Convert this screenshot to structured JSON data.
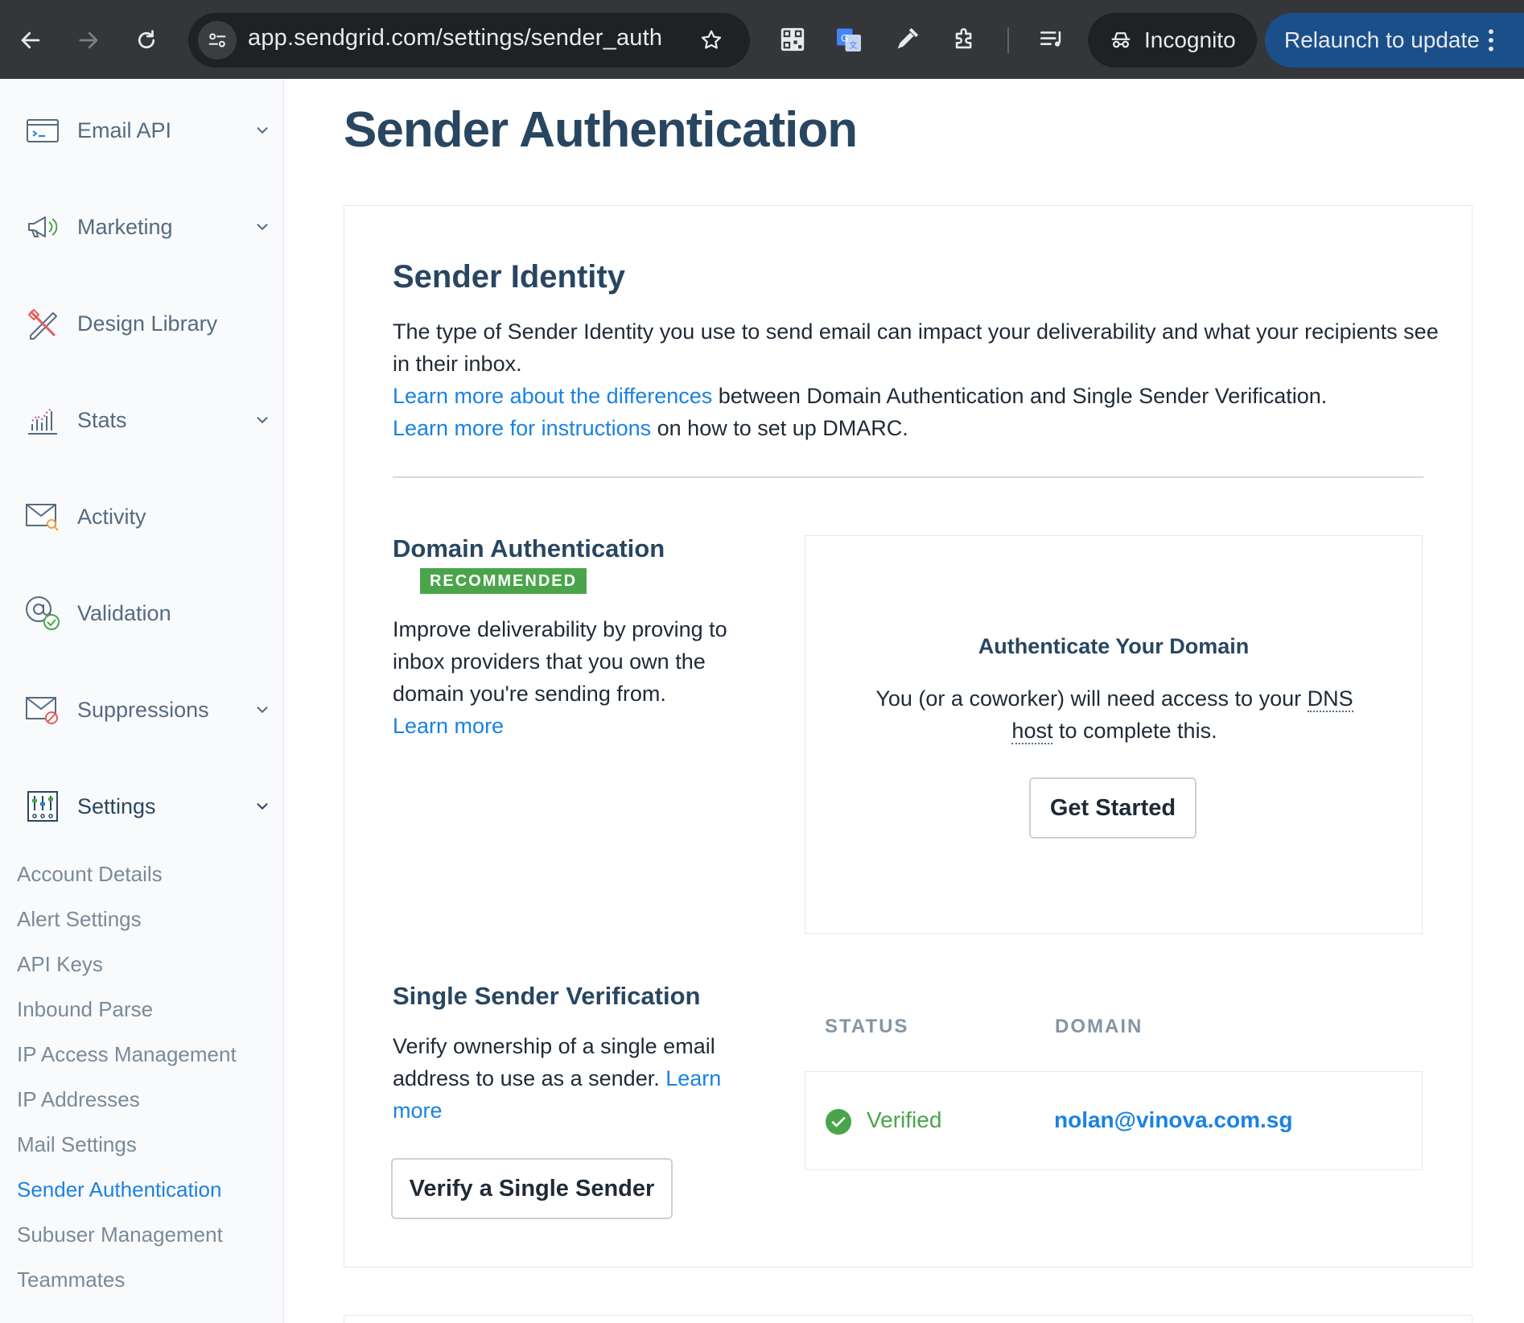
{
  "browser": {
    "url": "app.sendgrid.com/settings/sender_auth",
    "incognito_label": "Incognito",
    "relaunch_label": "Relaunch to update",
    "icons": [
      "back-arrow-icon",
      "forward-arrow-icon",
      "reload-icon",
      "site-info-icon",
      "star-icon",
      "qr-code-icon",
      "translate-icon",
      "eyedropper-icon",
      "puzzle-icon",
      "media-queue-icon",
      "incognito-icon",
      "kebab-menu-icon"
    ]
  },
  "sidebar": {
    "items": [
      {
        "label": "Email API",
        "icon": "terminal-icon",
        "expandable": true
      },
      {
        "label": "Marketing",
        "icon": "megaphone-icon",
        "expandable": true
      },
      {
        "label": "Design Library",
        "icon": "design-tools-icon",
        "expandable": false
      },
      {
        "label": "Stats",
        "icon": "bar-chart-icon",
        "expandable": true
      },
      {
        "label": "Activity",
        "icon": "mail-search-icon",
        "expandable": false
      },
      {
        "label": "Validation",
        "icon": "at-check-icon",
        "expandable": false
      },
      {
        "label": "Suppressions",
        "icon": "mail-block-icon",
        "expandable": true
      },
      {
        "label": "Settings",
        "icon": "sliders-icon",
        "expandable": true
      }
    ],
    "settings_sub": [
      "Account Details",
      "Alert Settings",
      "API Keys",
      "Inbound Parse",
      "IP Access Management",
      "IP Addresses",
      "Mail Settings",
      "Sender Authentication",
      "Subuser Management",
      "Teammates"
    ],
    "current_sub": "Sender Authentication"
  },
  "main": {
    "title": "Sender Authentication",
    "identity": {
      "heading": "Sender Identity",
      "intro": "The type of Sender Identity you use to send email can impact your deliverability and what your recipients see in their inbox.",
      "link1": "Learn more about the differences",
      "text1": " between Domain Authentication and Single Sender Verification.",
      "link2": "Learn more for instructions",
      "text2": " on how to set up DMARC."
    },
    "domain_auth": {
      "heading": "Domain Authentication",
      "badge": "RECOMMENDED",
      "body": "Improve deliverability by proving to inbox providers that you own the domain you're sending from.",
      "link": "Learn more",
      "box_title": "Authenticate Your Domain",
      "box_text_1": "You (or a coworker) will need access to your ",
      "box_dns": "DNS host",
      "box_text_2": " to complete this.",
      "button": "Get Started"
    },
    "single_sender": {
      "heading": "Single Sender Verification",
      "body": "Verify ownership of a single email address to use as a sender. ",
      "link": "Learn more",
      "button": "Verify a Single Sender",
      "col_status": "STATUS",
      "col_domain": "DOMAIN",
      "status": "Verified",
      "domain": "nolan@vinova.com.sg"
    }
  },
  "colors": {
    "brand_navy": "#294661",
    "link_blue": "#1a82e2",
    "success_green": "#4aa54a",
    "chrome_dark": "#35363a",
    "relaunch_blue": "#1a4f8a"
  }
}
